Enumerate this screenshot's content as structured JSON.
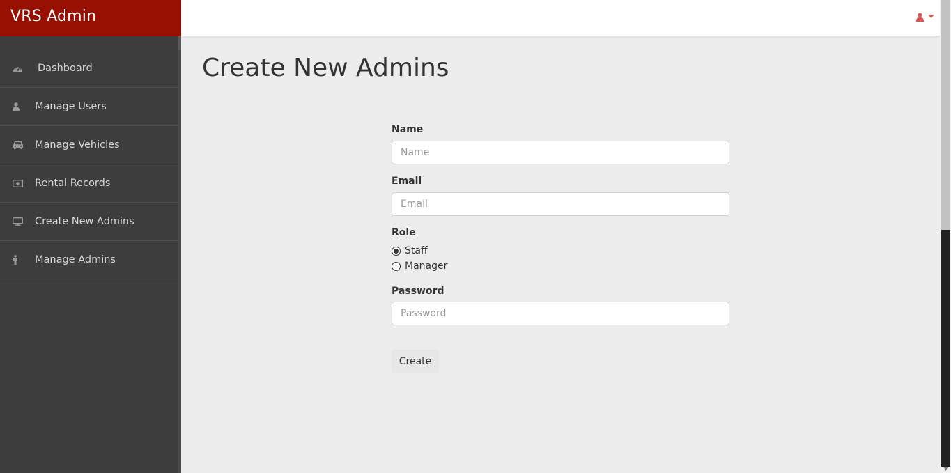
{
  "brand": {
    "title": "VRS Admin"
  },
  "topbar": {
    "user_icon": "user-icon",
    "caret_icon": "caret-down-icon",
    "accent": "#d9534f"
  },
  "sidebar": {
    "items": [
      {
        "label": "Dashboard",
        "icon": "dashboard-icon"
      },
      {
        "label": "Manage Users",
        "icon": "user-icon"
      },
      {
        "label": "Manage Vehicles",
        "icon": "car-icon"
      },
      {
        "label": "Rental Records",
        "icon": "money-icon"
      },
      {
        "label": "Create New Admins",
        "icon": "desktop-icon"
      },
      {
        "label": "Manage Admins",
        "icon": "male-icon"
      }
    ]
  },
  "main": {
    "title": "Create New Admins",
    "form": {
      "name_label": "Name",
      "name_placeholder": "Name",
      "email_label": "Email",
      "email_placeholder": "Email",
      "role_label": "Role",
      "role_options": [
        {
          "label": "Staff",
          "selected": true
        },
        {
          "label": "Manager",
          "selected": false
        }
      ],
      "password_label": "Password",
      "password_placeholder": "Password",
      "submit_label": "Create"
    }
  },
  "colors": {
    "brand_bg": "#971002",
    "sidebar_bg": "#3d3d3d",
    "content_bg": "#ececec"
  }
}
